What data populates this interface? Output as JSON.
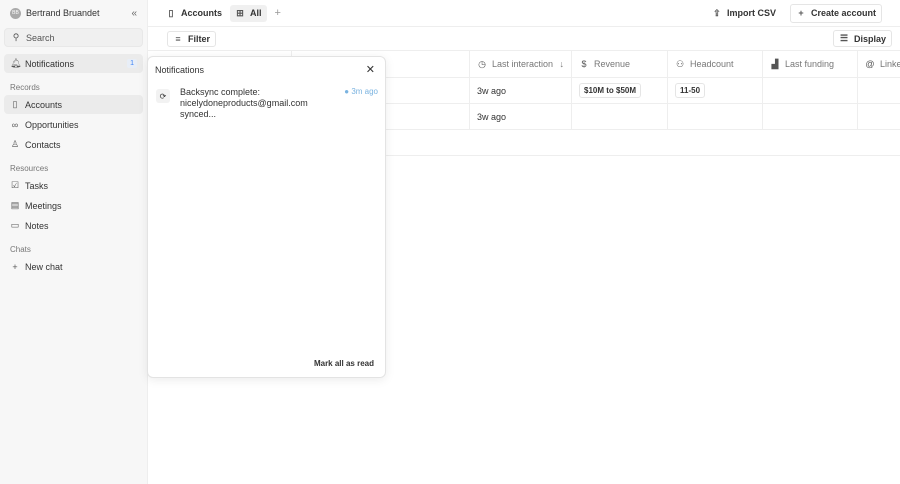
{
  "sidebar": {
    "user": {
      "name": "Bertrand Bruandet",
      "initials": "BB"
    },
    "search": "Search",
    "notifications": {
      "label": "Notifications",
      "count": "1"
    },
    "records_label": "Records",
    "records": [
      "Accounts",
      "Opportunities",
      "Contacts"
    ],
    "resources_label": "Resources",
    "resources": [
      "Tasks",
      "Meetings",
      "Notes"
    ],
    "chats_label": "Chats",
    "new_chat": "New chat"
  },
  "header": {
    "object": "Accounts",
    "view": "All",
    "import": "Import CSV",
    "create": "Create account"
  },
  "toolbar": {
    "filter": "Filter",
    "display": "Display"
  },
  "table": {
    "columns": [
      "Last interaction",
      "Revenue",
      "Headcount",
      "Last funding",
      "Linked"
    ],
    "rows": [
      {
        "last_interaction": "3w ago",
        "revenue": "$10M to $50M",
        "headcount": "11-50"
      },
      {
        "last_interaction": "3w ago"
      }
    ]
  },
  "popup": {
    "title": "Notifications",
    "items": [
      {
        "line1": "Backsync complete:",
        "line2": "nicelydoneproducts@gmail.com synced...",
        "time": "3m ago"
      }
    ],
    "mark_all": "Mark all as read"
  }
}
